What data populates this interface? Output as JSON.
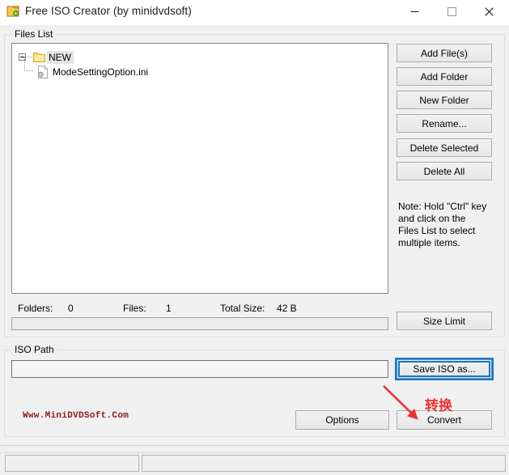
{
  "window": {
    "title": "Free ISO Creator (by minidvdsoft)",
    "icon": "disc-app-icon",
    "controls": {
      "minimize": "minimize-icon",
      "maximize": "maximize-icon",
      "close": "close-icon"
    }
  },
  "files_list_group": {
    "label": "Files List",
    "tree": {
      "folder": {
        "name": "NEW",
        "expanded": true,
        "selected": true,
        "icon": "folder-icon"
      },
      "file": {
        "name": "ModeSettingOption.ini",
        "icon": "ini-file-icon"
      }
    },
    "buttons": [
      {
        "id": "add-files",
        "label": "Add File(s)"
      },
      {
        "id": "add-folder",
        "label": "Add Folder"
      },
      {
        "id": "new-folder",
        "label": "New Folder"
      },
      {
        "id": "rename",
        "label": "Rename..."
      },
      {
        "id": "delete-selected",
        "label": "Delete Selected"
      },
      {
        "id": "delete-all",
        "label": "Delete All"
      }
    ],
    "note": "Note: Hold \"Ctrl\" key and click on the Files List to select multiple items.",
    "stats": {
      "folders_label": "Folders:",
      "folders_value": "0",
      "files_label": "Files:",
      "files_value": "1",
      "size_label": "Total Size:",
      "size_value": "42 B"
    },
    "size_limit_label": "Size Limit",
    "progress_value": 0
  },
  "iso_path_group": {
    "label": "ISO Path",
    "input_value": "",
    "input_placeholder": "",
    "save_button_label": "Save ISO as...",
    "save_button_focused": true
  },
  "footer": {
    "watermark": "Www.MiniDVDSoft.Com",
    "options_label": "Options",
    "convert_label": "Convert"
  },
  "annotation": {
    "text": "转换",
    "color": "#f03030",
    "arrow": "red-arrow-pointing-to-convert"
  },
  "status_bar": {
    "panel_1": "",
    "panel_2": ""
  }
}
